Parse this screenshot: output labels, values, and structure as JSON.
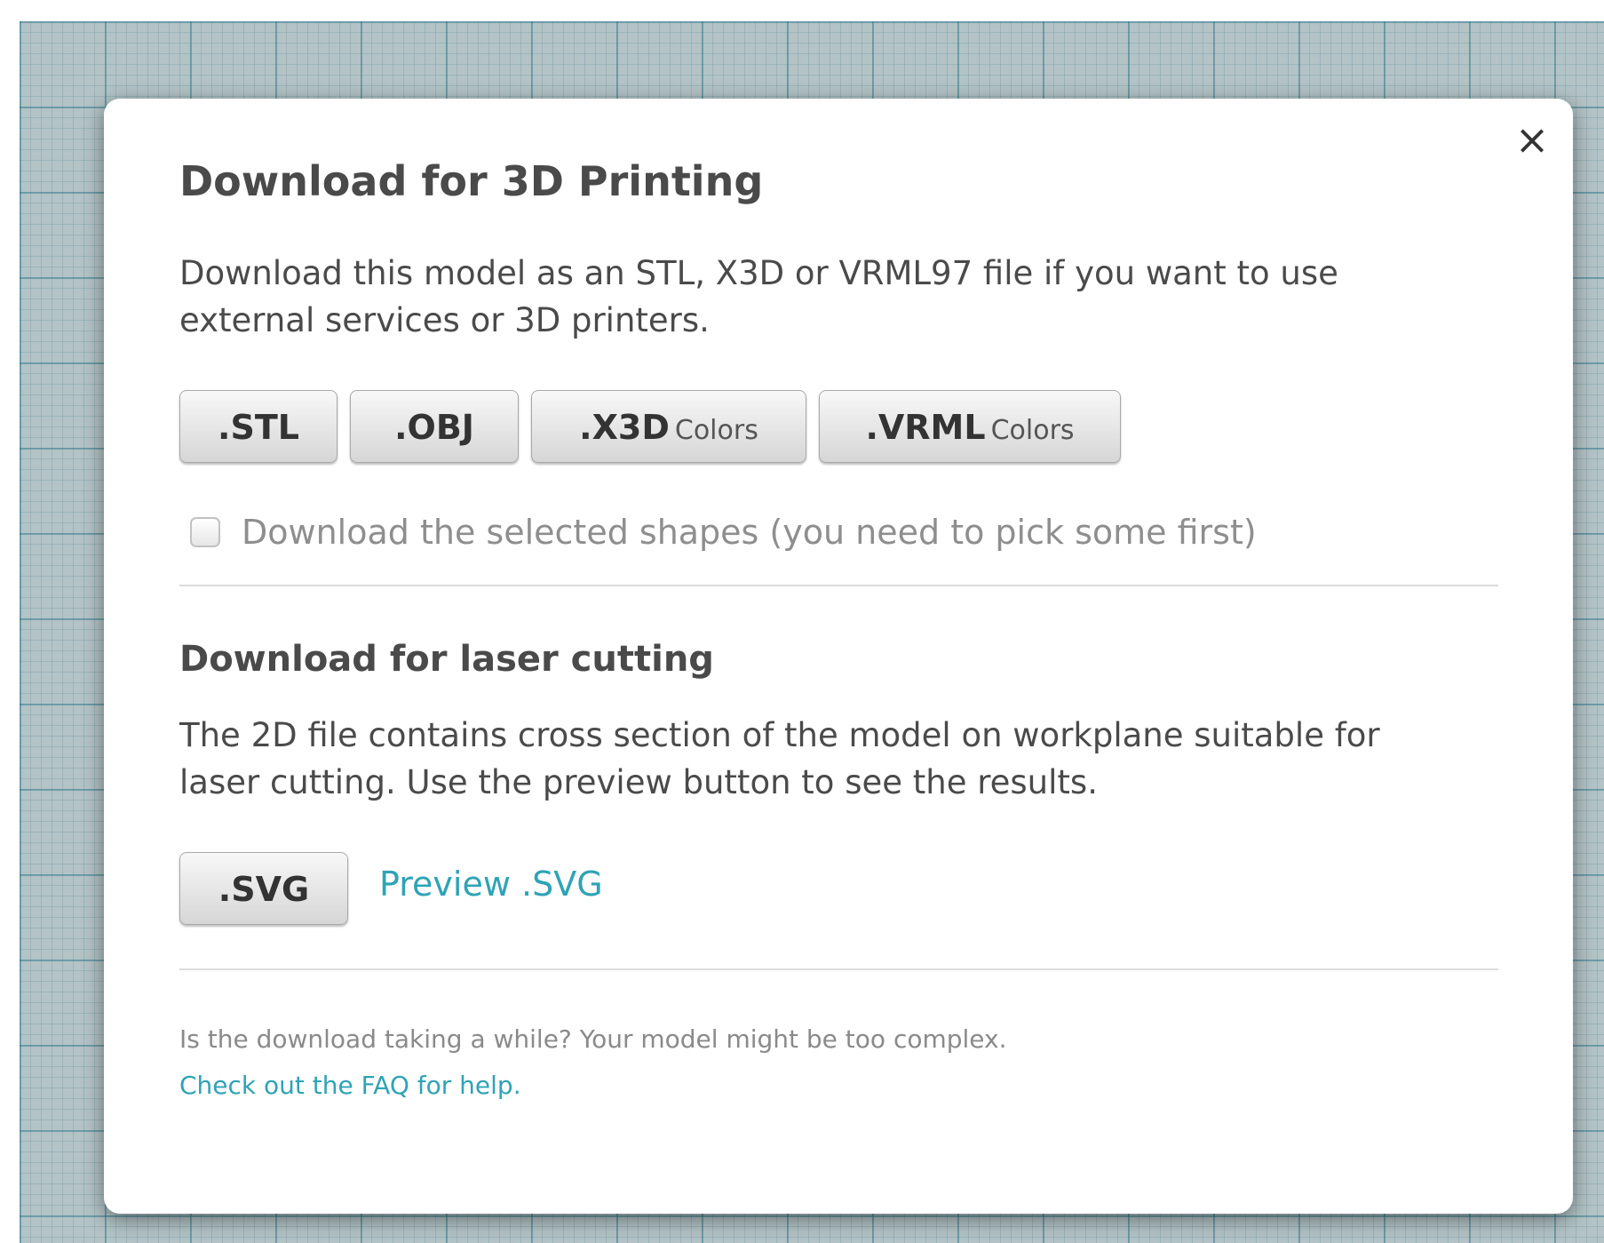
{
  "dialog": {
    "close_symbol": "×",
    "print_section": {
      "title": "Download for 3D Printing",
      "description": "Download this model as an STL, X3D or VRML97 file if you want to use external services or 3D printers.",
      "buttons": [
        {
          "label": ".STL",
          "sub": ""
        },
        {
          "label": ".OBJ",
          "sub": ""
        },
        {
          "label": ".X3D",
          "sub": "Colors"
        },
        {
          "label": ".VRML",
          "sub": "Colors"
        }
      ],
      "checkbox_label": "Download the selected shapes (you need to pick some first)"
    },
    "laser_section": {
      "title": "Download for laser cutting",
      "description": "The 2D file contains cross section of the model on workplane suitable for laser cutting. Use the preview button to see the results.",
      "svg_button_label": ".SVG",
      "preview_link": "Preview .SVG"
    },
    "footer": {
      "note": "Is the download taking a while? Your model might be too complex.",
      "faq_link": "Check out the FAQ for help."
    }
  },
  "colors": {
    "accent_link": "#2fa3b6",
    "grid_background": "#b3c3c6"
  },
  "icons": {
    "close": "close-icon"
  }
}
